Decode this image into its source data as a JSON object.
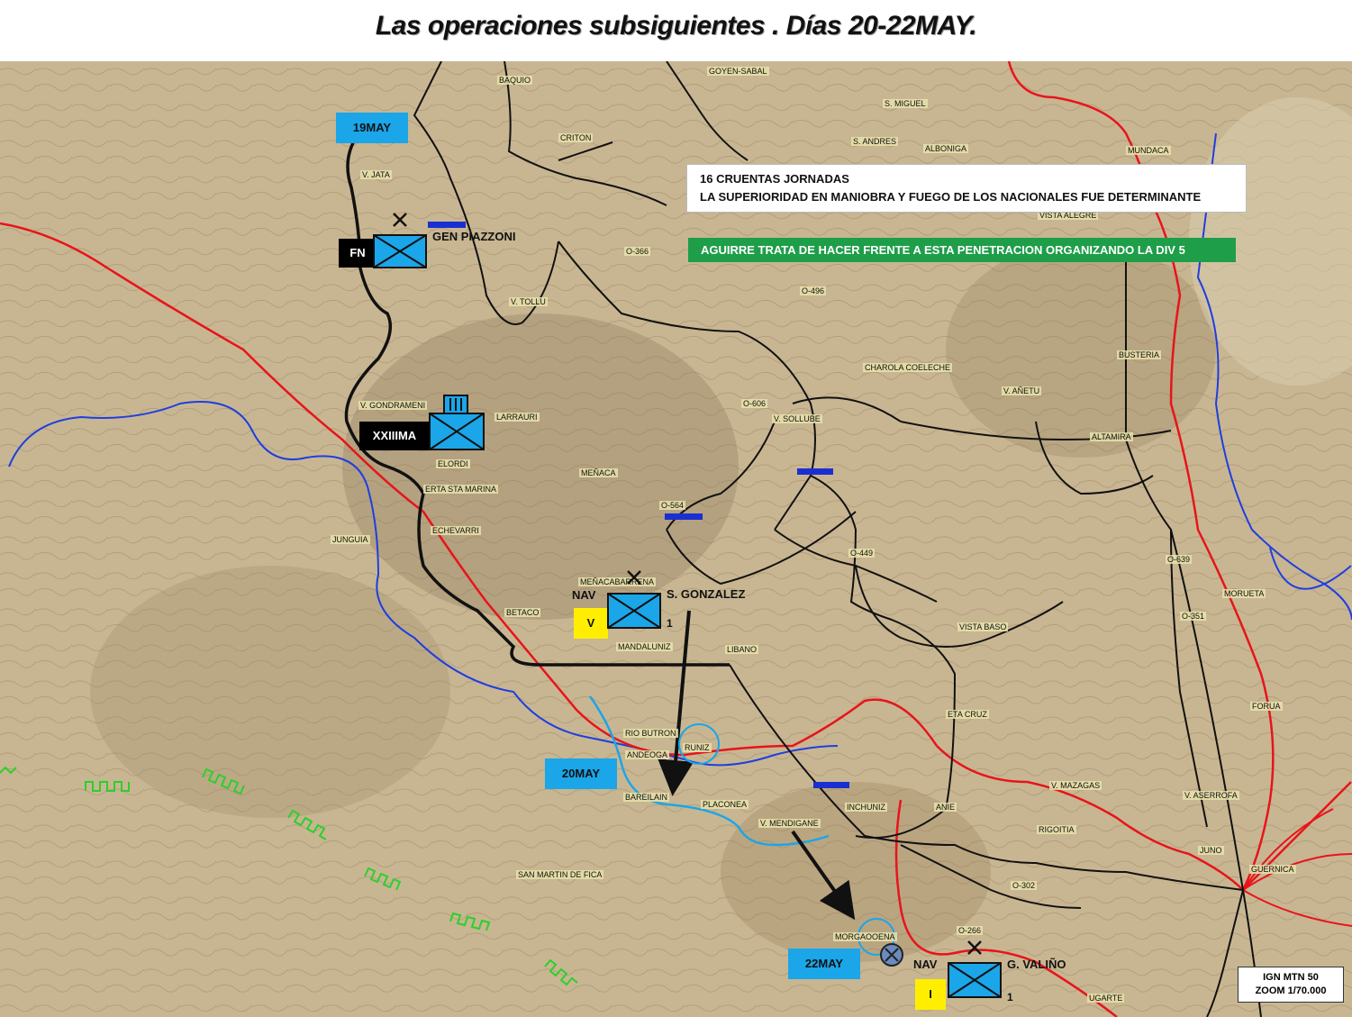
{
  "title": "Las operaciones subsiguientes . Días 20-22MAY.",
  "notes": {
    "white_line1": "16 CRUENTAS JORNADAS",
    "white_line2": "LA SUPERIORIDAD EN MANIOBRA Y FUEGO DE LOS NACIONALES FUE DETERMINANTE",
    "green": "AGUIRRE TRATA DE HACER FRENTE  A ESTA PENETRACION ORGANIZANDO  LA DIV 5"
  },
  "dates": {
    "d1": "19MAY",
    "d2": "20MAY",
    "d3": "22MAY"
  },
  "units": {
    "fn": {
      "tag": "FN",
      "commander": "GEN PIAZZONI"
    },
    "xxiii": {
      "tag": "XXIIIMA"
    },
    "sgonzalez": {
      "origin": "NAV",
      "brigade": "V",
      "commander": "S. GONZALEZ",
      "number": "1"
    },
    "valino": {
      "origin": "NAV",
      "brigade": "I",
      "commander": "G. VALIÑO",
      "number": "1"
    }
  },
  "scale": {
    "line1": "IGN MTN 50",
    "line2": "ZOOM 1/70.000"
  },
  "places": [
    "BAQUIO",
    "GOYEN-SABAL",
    "S. MIGUEL",
    "S. ANDRES",
    "ALBONIGA",
    "MUNDACA",
    "CRITON",
    "V. JATA",
    "VISTA ALEGRE",
    "O-366",
    "V. TOLLU",
    "O-496",
    "BUSTERIA",
    "CHAROLA COELECHE",
    "V. AÑETU",
    "V. GONDRAMENI",
    "LARRAURI",
    "O-606",
    "V. SOLLUBE",
    "ALTAMIRA",
    "ELORDI",
    "MEÑACA",
    "ERTA STA MARINA",
    "O-564",
    "JUNGUIA",
    "ECHEVARRI",
    "O-449",
    "O-639",
    "MEÑACABARRENA",
    "MORUETA",
    "O-351",
    "BETACO",
    "VISTA BASO",
    "MANDALUNIZ",
    "LIBANO",
    "FORUA",
    "ETA CRUZ",
    "RIO BUTRON",
    "ANDEOGA",
    "RUNIZ",
    "V. MAZAGAS",
    "INCHUNIZ",
    "ANIE",
    "V. ASERROFA",
    "BAREILAIN",
    "PLACONEA",
    "V. MENDIGANE",
    "RIGOITIA",
    "JUNO",
    "GUERNICA",
    "SAN MARTIN DE FICA",
    "O-302",
    "MORGAOOENA",
    "O-266",
    "UGARTE"
  ],
  "colors": {
    "front": "#e8141b",
    "river": "#1f3ee0",
    "road": "#111111",
    "unit": "#1aa6e8",
    "date": "#1aa6e8"
  },
  "icons": [
    "unit-infantry-icon",
    "hq-flag-icon",
    "destroyed-x-icon",
    "arrow-icon",
    "circle-marker-icon"
  ]
}
